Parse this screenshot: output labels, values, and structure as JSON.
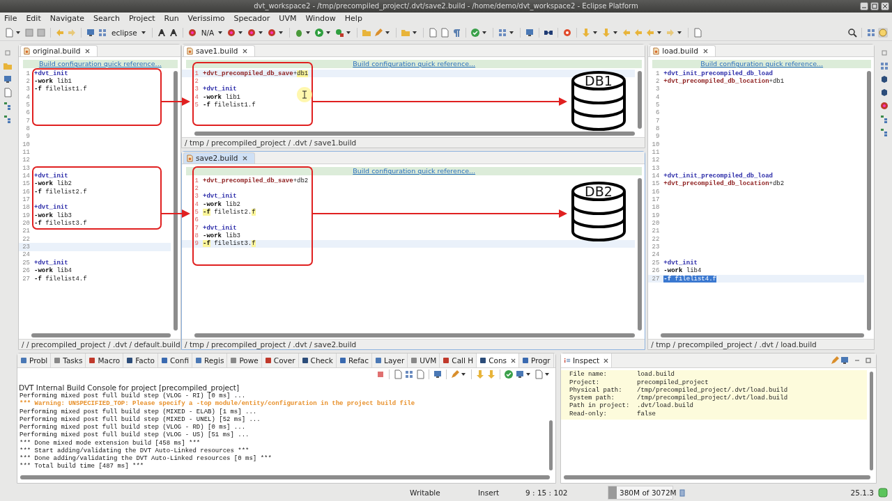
{
  "window": {
    "title": "dvt_workspace2 - /tmp/precompiled_project/.dvt/save2.build - /home/demo/dvt_workspace2 - Eclipse Platform"
  },
  "menu": [
    "File",
    "Edit",
    "Navigate",
    "Search",
    "Project",
    "Run",
    "Verissimo",
    "Specador",
    "UVM",
    "Window",
    "Help"
  ],
  "toolbar": {
    "combos": [
      {
        "label": "eclipse"
      },
      {
        "label": "N/A"
      }
    ]
  },
  "editors": [
    {
      "tab": "original.build",
      "selected": false,
      "quick_reference": "Build configuration quick reference...",
      "breadcrumb": "/ / precompiled_project / .dvt / default.build",
      "lines": [
        {
          "number": "1",
          "current": false,
          "tokens": [
            {
              "kind": "directive",
              "text": "+dvt_init",
              "highlighted": false,
              "selected": false
            }
          ]
        },
        {
          "number": "2",
          "current": false,
          "tokens": [
            {
              "kind": "flag",
              "text": "-work",
              "highlighted": false,
              "selected": false
            },
            {
              "kind": "plain",
              "text": " lib1",
              "highlighted": false,
              "selected": false
            }
          ]
        },
        {
          "number": "3",
          "current": false,
          "tokens": [
            {
              "kind": "flag",
              "text": "-f",
              "highlighted": false,
              "selected": false
            },
            {
              "kind": "plain",
              "text": " filelist1.f",
              "highlighted": false,
              "selected": false
            }
          ]
        },
        {
          "number": "4",
          "current": false
        },
        {
          "number": "5",
          "current": false
        },
        {
          "number": "6",
          "current": false
        },
        {
          "number": "7",
          "current": false
        },
        {
          "number": "8",
          "current": false
        },
        {
          "number": "9",
          "current": false
        },
        {
          "number": "10",
          "current": false
        },
        {
          "number": "11",
          "current": false
        },
        {
          "number": "12",
          "current": false
        },
        {
          "number": "13",
          "current": false
        },
        {
          "number": "14",
          "current": false,
          "tokens": [
            {
              "kind": "directive",
              "text": "+dvt_init",
              "highlighted": false,
              "selected": false
            }
          ]
        },
        {
          "number": "15",
          "current": false,
          "tokens": [
            {
              "kind": "flag",
              "text": "-work",
              "highlighted": false,
              "selected": false
            },
            {
              "kind": "plain",
              "text": " lib2",
              "highlighted": false,
              "selected": false
            }
          ]
        },
        {
          "number": "16",
          "current": false,
          "tokens": [
            {
              "kind": "flag",
              "text": "-f",
              "highlighted": false,
              "selected": false
            },
            {
              "kind": "plain",
              "text": " filelist2.f",
              "highlighted": false,
              "selected": false
            }
          ]
        },
        {
          "number": "17",
          "current": false
        },
        {
          "number": "18",
          "current": false,
          "tokens": [
            {
              "kind": "directive",
              "text": "+dvt_init",
              "highlighted": false,
              "selected": false
            }
          ]
        },
        {
          "number": "19",
          "current": false,
          "tokens": [
            {
              "kind": "flag",
              "text": "-work",
              "highlighted": false,
              "selected": false
            },
            {
              "kind": "plain",
              "text": " lib3",
              "highlighted": false,
              "selected": false
            }
          ]
        },
        {
          "number": "20",
          "current": false,
          "tokens": [
            {
              "kind": "flag",
              "text": "-f",
              "highlighted": false,
              "selected": false
            },
            {
              "kind": "plain",
              "text": " filelist3.f",
              "highlighted": false,
              "selected": false
            }
          ]
        },
        {
          "number": "21",
          "current": false
        },
        {
          "number": "22",
          "current": false
        },
        {
          "number": "23",
          "current": true
        },
        {
          "number": "24",
          "current": false
        },
        {
          "number": "25",
          "current": false,
          "tokens": [
            {
              "kind": "directive",
              "text": "+dvt_init",
              "highlighted": false,
              "selected": false
            }
          ]
        },
        {
          "number": "26",
          "current": false,
          "tokens": [
            {
              "kind": "flag",
              "text": "-work",
              "highlighted": false,
              "selected": false
            },
            {
              "kind": "plain",
              "text": " lib4",
              "highlighted": false,
              "selected": false
            }
          ]
        },
        {
          "number": "27",
          "current": false,
          "tokens": [
            {
              "kind": "flag",
              "text": "-f",
              "highlighted": false,
              "selected": false
            },
            {
              "kind": "plain",
              "text": " filelist4.f",
              "highlighted": false,
              "selected": false
            }
          ]
        }
      ]
    },
    {
      "tab": "save1.build",
      "selected": false,
      "quick_reference": "Build configuration quick reference...",
      "breadcrumb": "/ tmp / precompiled_project / .dvt / save1.build",
      "database_label": "DB1",
      "lines": [
        {
          "number": "1",
          "current": true,
          "tokens": [
            {
              "kind": "option",
              "text": "+dvt_precompiled_db_save",
              "highlighted": false,
              "selected": false
            },
            {
              "kind": "plain",
              "text": "+",
              "highlighted": false,
              "selected": false
            },
            {
              "kind": "plain",
              "text": "db1",
              "highlighted": true,
              "selected": false
            }
          ]
        },
        {
          "number": "2",
          "current": false
        },
        {
          "number": "3",
          "current": false,
          "tokens": [
            {
              "kind": "directive",
              "text": "+dvt_init",
              "highlighted": false,
              "selected": false
            }
          ]
        },
        {
          "number": "4",
          "current": false,
          "tokens": [
            {
              "kind": "flag",
              "text": "-work",
              "highlighted": false,
              "selected": false
            },
            {
              "kind": "plain",
              "text": " lib1",
              "highlighted": false,
              "selected": false
            }
          ]
        },
        {
          "number": "5",
          "current": false,
          "tokens": [
            {
              "kind": "flag",
              "text": "-f",
              "highlighted": false,
              "selected": false
            },
            {
              "kind": "plain",
              "text": " filelist1.f",
              "highlighted": false,
              "selected": false
            }
          ]
        }
      ]
    },
    {
      "tab": "save2.build",
      "selected": true,
      "quick_reference": "Build configuration quick reference...",
      "breadcrumb": "/ tmp / precompiled_project / .dvt / save2.build",
      "database_label": "DB2",
      "lines": [
        {
          "number": "1",
          "current": false,
          "tokens": [
            {
              "kind": "option",
              "text": "+dvt_precompiled_db_save",
              "highlighted": false,
              "selected": false
            },
            {
              "kind": "plain",
              "text": "+db2",
              "highlighted": false,
              "selected": false
            }
          ]
        },
        {
          "number": "2",
          "current": false
        },
        {
          "number": "3",
          "current": false,
          "tokens": [
            {
              "kind": "directive",
              "text": "+dvt_init",
              "highlighted": false,
              "selected": false
            }
          ]
        },
        {
          "number": "4",
          "current": false,
          "tokens": [
            {
              "kind": "flag",
              "text": "-work",
              "highlighted": false,
              "selected": false
            },
            {
              "kind": "plain",
              "text": " lib2",
              "highlighted": false,
              "selected": false
            }
          ]
        },
        {
          "number": "5",
          "current": false,
          "tokens": [
            {
              "kind": "flag",
              "text": "-f",
              "highlighted": true,
              "selected": false
            },
            {
              "kind": "plain",
              "text": " filelist2.",
              "highlighted": false,
              "selected": false
            },
            {
              "kind": "plain",
              "text": "f",
              "highlighted": true,
              "selected": false
            }
          ]
        },
        {
          "number": "6",
          "current": false
        },
        {
          "number": "7",
          "current": false,
          "tokens": [
            {
              "kind": "directive",
              "text": "+dvt_init",
              "highlighted": false,
              "selected": false
            }
          ]
        },
        {
          "number": "8",
          "current": false,
          "tokens": [
            {
              "kind": "flag",
              "text": "-work",
              "highlighted": false,
              "selected": false
            },
            {
              "kind": "plain",
              "text": " lib3",
              "highlighted": false,
              "selected": false
            }
          ]
        },
        {
          "number": "9",
          "current": true,
          "tokens": [
            {
              "kind": "flag",
              "text": "-f",
              "highlighted": true,
              "selected": false
            },
            {
              "kind": "plain",
              "text": " filelist3.",
              "highlighted": false,
              "selected": false
            },
            {
              "kind": "plain",
              "text": "f",
              "highlighted": true,
              "selected": false
            }
          ]
        }
      ]
    },
    {
      "tab": "load.build",
      "selected": false,
      "quick_reference": "Build configuration quick reference...",
      "breadcrumb": "/ tmp / precompiled_project / .dvt / load.build",
      "lines": [
        {
          "number": "1",
          "current": false,
          "tokens": [
            {
              "kind": "directive",
              "text": "+dvt_init_precompiled_db_load",
              "highlighted": false,
              "selected": false
            }
          ]
        },
        {
          "number": "2",
          "current": false,
          "tokens": [
            {
              "kind": "option",
              "text": "+dvt_precompiled_db_location",
              "highlighted": false,
              "selected": false
            },
            {
              "kind": "plain",
              "text": "+db1",
              "highlighted": false,
              "selected": false
            }
          ]
        },
        {
          "number": "3",
          "current": false
        },
        {
          "number": "4",
          "current": false
        },
        {
          "number": "5",
          "current": false
        },
        {
          "number": "6",
          "current": false
        },
        {
          "number": "7",
          "current": false
        },
        {
          "number": "8",
          "current": false
        },
        {
          "number": "9",
          "current": false
        },
        {
          "number": "10",
          "current": false
        },
        {
          "number": "11",
          "current": false
        },
        {
          "number": "12",
          "current": false
        },
        {
          "number": "13",
          "current": false
        },
        {
          "number": "14",
          "current": false,
          "tokens": [
            {
              "kind": "directive",
              "text": "+dvt_init_precompiled_db_load",
              "highlighted": false,
              "selected": false
            }
          ]
        },
        {
          "number": "15",
          "current": false,
          "tokens": [
            {
              "kind": "option",
              "text": "+dvt_precompiled_db_location",
              "highlighted": false,
              "selected": false
            },
            {
              "kind": "plain",
              "text": "+db2",
              "highlighted": false,
              "selected": false
            }
          ]
        },
        {
          "number": "16",
          "current": false
        },
        {
          "number": "17",
          "current": false
        },
        {
          "number": "18",
          "current": false
        },
        {
          "number": "19",
          "current": false
        },
        {
          "number": "20",
          "current": false
        },
        {
          "number": "21",
          "current": false
        },
        {
          "number": "22",
          "current": false
        },
        {
          "number": "23",
          "current": false
        },
        {
          "number": "24",
          "current": false
        },
        {
          "number": "25",
          "current": false,
          "tokens": [
            {
              "kind": "directive",
              "text": "+dvt_init",
              "highlighted": false,
              "selected": false
            }
          ]
        },
        {
          "number": "26",
          "current": false,
          "tokens": [
            {
              "kind": "flag",
              "text": "-work",
              "highlighted": false,
              "selected": false
            },
            {
              "kind": "plain",
              "text": " lib4",
              "highlighted": false,
              "selected": false
            }
          ]
        },
        {
          "number": "27",
          "current": true,
          "tokens": [
            {
              "kind": "flag",
              "text": "-f",
              "highlighted": false,
              "selected": true
            },
            {
              "kind": "plain",
              "text": " filelist4.f",
              "highlighted": false,
              "selected": true
            }
          ]
        }
      ]
    }
  ],
  "bottom_tabs": [
    {
      "label": "Probl",
      "selected": false
    },
    {
      "label": "Tasks",
      "selected": false
    },
    {
      "label": "Macro",
      "selected": false
    },
    {
      "label": "Facto",
      "selected": false
    },
    {
      "label": "Confi",
      "selected": false
    },
    {
      "label": "Regis",
      "selected": false
    },
    {
      "label": "Powe",
      "selected": false
    },
    {
      "label": "Cover",
      "selected": false
    },
    {
      "label": "Check",
      "selected": false
    },
    {
      "label": "Refac",
      "selected": false
    },
    {
      "label": "Layer",
      "selected": false
    },
    {
      "label": "UVM",
      "selected": false
    },
    {
      "label": "Call H",
      "selected": false
    },
    {
      "label": "Cons",
      "selected": true
    },
    {
      "label": "Progr",
      "selected": false
    }
  ],
  "console": {
    "title": "DVT Internal Build Console for project [precompiled_project]",
    "lines": [
      {
        "kind": "normal",
        "text": "Performing mixed post full build step (VLOG - RI) [0 ms] ..."
      },
      {
        "kind": "warning",
        "text": "*** Warning: UNSPECIFIED_TOP: Please specify a -top module/entity/configuration in the project build file"
      },
      {
        "kind": "normal",
        "text": "Performing mixed post full build step (MIXED - ELAB) [1 ms] ..."
      },
      {
        "kind": "normal",
        "text": "Performing mixed post full build step (MIXED - UNEL) [52 ms] ..."
      },
      {
        "kind": "normal",
        "text": "Performing mixed post full build step (VLOG - RD) [0 ms] ..."
      },
      {
        "kind": "normal",
        "text": "Performing mixed post full build step (VLOG - US) [51 ms] ..."
      },
      {
        "kind": "normal",
        "text": "*** Done mixed mode extension build [458 ms] ***"
      },
      {
        "kind": "normal",
        "text": "*** Start adding/validating the DVT Auto-Linked resources ***"
      },
      {
        "kind": "normal",
        "text": "*** Done adding/validating the DVT Auto-Linked resources [0 ms] ***"
      },
      {
        "kind": "normal",
        "text": "*** Total build time [487 ms] ***"
      }
    ]
  },
  "inspect": {
    "tab": "Inspect",
    "rows": [
      {
        "label": "File name:",
        "value": "load.build"
      },
      {
        "label": "Project:",
        "value": "precompiled_project"
      },
      {
        "label": "Physical path:",
        "value": "/tmp/precompiled_project/.dvt/load.build"
      },
      {
        "label": "System path:",
        "value": "/tmp/precompiled_project/.dvt/load.build"
      },
      {
        "label": "Path in project:",
        "value": ".dvt/load.build"
      },
      {
        "label": "Read-only:",
        "value": "false"
      }
    ]
  },
  "status_bar": {
    "mode": "Writable",
    "insert": "Insert",
    "position": "9 : 15 : 102",
    "memory": {
      "text": "380M of 3072M",
      "level": 0.13
    },
    "version": "25.1.3"
  }
}
